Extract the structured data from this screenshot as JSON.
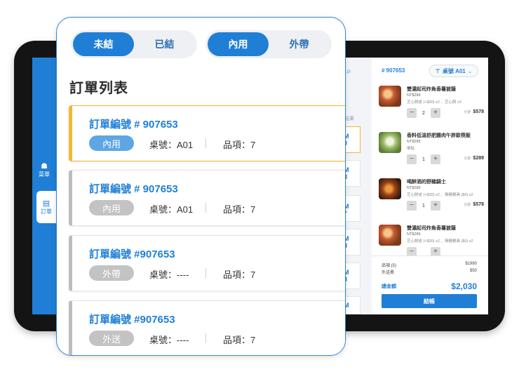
{
  "phone": {
    "status_tabs": [
      {
        "label": "未結",
        "active": true
      },
      {
        "label": "已結",
        "active": false
      }
    ],
    "type_tabs": [
      {
        "label": "內用",
        "active": true
      },
      {
        "label": "外帶",
        "active": false
      }
    ],
    "title": "訂單列表",
    "orders": [
      {
        "number": "訂單編號 # 907653",
        "type": "內用",
        "table": "桌號：A01",
        "items": "品項：7",
        "selected": true
      },
      {
        "number": "訂單編號 # 907653",
        "type": "內用",
        "table": "桌號：A01",
        "items": "品項：7",
        "selected": false
      },
      {
        "number": "訂單編號 #907653",
        "type": "外帶",
        "table": "桌號：----",
        "items": "品項：7",
        "selected": false
      },
      {
        "number": "訂單編號 #907653",
        "type": "外送",
        "table": "桌號：----",
        "items": "品項：7",
        "selected": false
      }
    ]
  },
  "tablet": {
    "nav": [
      {
        "label": "菜單",
        "icon": "chef-icon",
        "active": false
      },
      {
        "label": "訂單",
        "icon": "clipboard-icon",
        "active": true
      }
    ],
    "list_fragment": {
      "meta": "項結果",
      "cards": [
        {
          "a": "M",
          "b": "0"
        },
        {
          "a": "M",
          "b": "8"
        },
        {
          "a": "M",
          "b": ""
        },
        {
          "a": "M",
          "b": "8"
        },
        {
          "a": "M",
          "b": "8"
        },
        {
          "a": "M",
          "b": "8"
        }
      ]
    },
    "detail": {
      "order_no": "# 907653",
      "table_label": "桌號 A01",
      "items": [
        {
          "name": "雙濃起司炸魚香薯披薩",
          "price": "NT$289",
          "options": "芝心餅皮 (+$30) x2 、芝心餅 x3",
          "qty": "2",
          "subtotal_label": "小計",
          "subtotal": "$578"
        },
        {
          "name": "香料低溫舒肥雞肉午胖歐筷飯",
          "price": "NT$289",
          "options": "單點",
          "qty": "1",
          "subtotal_label": "小計",
          "subtotal": "$289"
        },
        {
          "name": "喝醉酒的野豬騎士",
          "price": "NT$289",
          "options": "芝心餅皮 (+$30) x2 、無糖餐具 ($0) x2",
          "qty": "1",
          "subtotal_label": "小計",
          "subtotal": "$578"
        },
        {
          "name": "雙濃起司炸魚香薯披薩",
          "price": "NT$289",
          "options": "芝心餅皮 (+$30) x2 、無糖餐具 ($0) x2",
          "qty": "",
          "subtotal_label": "",
          "subtotal": ""
        }
      ],
      "summary": {
        "items_label": "品項 (5)",
        "items_value": "$1980",
        "delivery_label": "外送費",
        "delivery_value": "$50",
        "total_label": "總金額",
        "total_value": "$2,030"
      },
      "checkout_label": "結帳"
    }
  },
  "colors": {
    "primary": "#1f7fd6",
    "highlight": "#f5b731",
    "muted": "#c3c3c3"
  }
}
